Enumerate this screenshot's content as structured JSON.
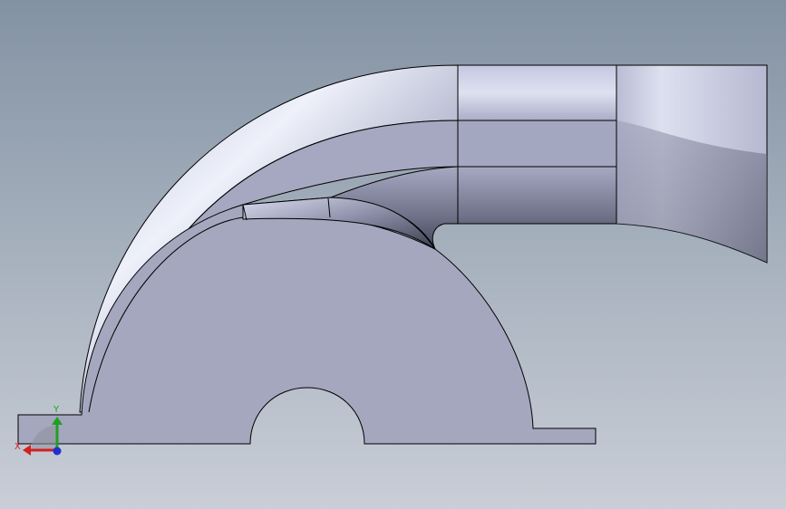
{
  "viewport": {
    "colors": {
      "background_top": "#8392a3",
      "background_bottom": "#c9ced7",
      "part_face": "#a3a6ba",
      "part_edge": "#000000"
    }
  },
  "triad": {
    "x_label": "X",
    "y_label": "Y",
    "colors": {
      "x": "#d32020",
      "y": "#20a020",
      "z": "#2030d0"
    }
  }
}
